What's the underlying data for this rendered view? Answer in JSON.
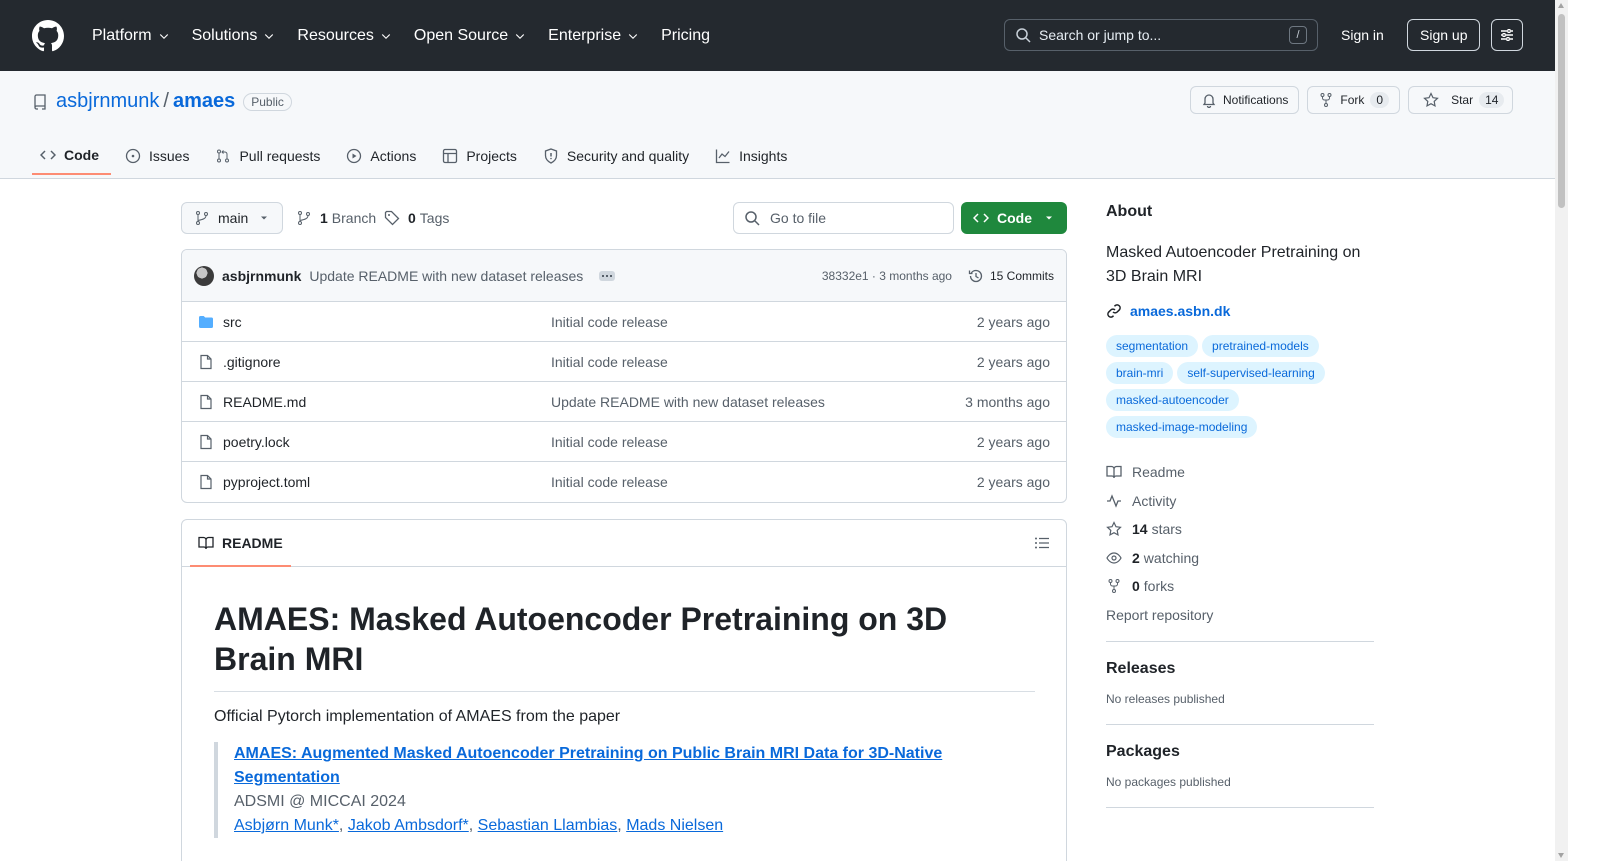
{
  "header": {
    "nav": [
      "Platform",
      "Solutions",
      "Resources",
      "Open Source",
      "Enterprise",
      "Pricing"
    ],
    "search_placeholder": "Search or jump to...",
    "search_shortcut": "/",
    "sign_in": "Sign in",
    "sign_up": "Sign up"
  },
  "repo": {
    "owner": "asbjrnmunk",
    "separator": "/",
    "name": "amaes",
    "visibility": "Public",
    "notifications_label": "Notifications",
    "fork_label": "Fork",
    "fork_count": "0",
    "star_label": "Star",
    "star_count": "14"
  },
  "tabs": [
    "Code",
    "Issues",
    "Pull requests",
    "Actions",
    "Projects",
    "Security and quality",
    "Insights"
  ],
  "toolbar": {
    "branch": "main",
    "branches_count": "1",
    "branches_label": "Branch",
    "tags_count": "0",
    "tags_label": "Tags",
    "goto_file": "Go to file",
    "code_button": "Code"
  },
  "latest_commit": {
    "author": "asbjrnmunk",
    "message": "Update README with new dataset releases",
    "hash_time": "38332e1 · 3 months ago",
    "commits": "15 Commits"
  },
  "files": [
    {
      "name": "src",
      "type": "dir",
      "message": "Initial code release",
      "age": "2 years ago"
    },
    {
      "name": ".gitignore",
      "type": "file",
      "message": "Initial code release",
      "age": "2 years ago"
    },
    {
      "name": "README.md",
      "type": "file",
      "message": "Update README with new dataset releases",
      "age": "3 months ago"
    },
    {
      "name": "poetry.lock",
      "type": "file",
      "message": "Initial code release",
      "age": "2 years ago"
    },
    {
      "name": "pyproject.toml",
      "type": "file",
      "message": "Initial code release",
      "age": "2 years ago"
    }
  ],
  "readme": {
    "tab_label": "README",
    "title": "AMAES: Masked Autoencoder Pretraining on 3D Brain MRI",
    "intro": "Official Pytorch implementation of AMAES from the paper",
    "paper_title": "AMAES: Augmented Masked Autoencoder Pretraining on Public Brain MRI Data for 3D-Native Segmentation",
    "venue": "ADSMI @ MICCAI 2024",
    "authors": [
      "Asbjørn Munk*",
      "Jakob Ambsdorf*",
      "Sebastian Llambias",
      "Mads Nielsen"
    ],
    "author_sep": ", "
  },
  "about": {
    "heading": "About",
    "description": "Masked Autoencoder Pretraining on 3D Brain MRI",
    "homepage": "amaes.asbn.dk",
    "topics": [
      "segmentation",
      "pretrained-models",
      "brain-mri",
      "self-supervised-learning",
      "masked-autoencoder",
      "masked-image-modeling"
    ],
    "readme": "Readme",
    "activity": "Activity",
    "stars_count": "14",
    "stars_label": "stars",
    "watching_count": "2",
    "watching_label": "watching",
    "forks_count": "0",
    "forks_label": "forks",
    "report": "Report repository"
  },
  "releases": {
    "heading": "Releases",
    "note": "No releases published"
  },
  "packages": {
    "heading": "Packages",
    "note": "No packages published"
  },
  "colors": {
    "header_bg": "#24292f",
    "link": "#0969da",
    "code_button": "#1f883d",
    "active_tab_underline": "#fd8c73",
    "topic_bg": "#ddf4ff"
  }
}
